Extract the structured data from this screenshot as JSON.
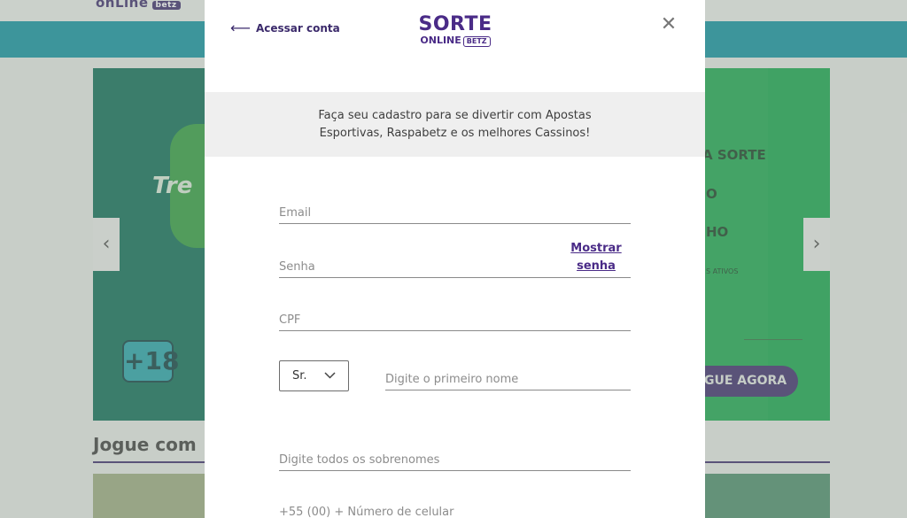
{
  "background": {
    "logo_text": "onLine",
    "logo_badge": "betz",
    "hero_brand": "Tre",
    "hero_lines": [
      "A SORTE",
      "O",
      "HO"
    ],
    "hero_small": "S ATIVOS",
    "age_badge": "+18",
    "play_button": "GUE AGORA",
    "section_title": "Jogue com",
    "arrow_left": "‹",
    "arrow_right": "›"
  },
  "modal": {
    "back_arrow": "⟵",
    "back_label": "Acessar conta",
    "logo_line1": "SORTE",
    "logo_line2": "ONLINE",
    "logo_badge": "BETZ",
    "close_symbol": "✕",
    "intro_text": "Faça seu cadastro para se divertir com Apostas Esportivas, Raspabetz e os melhores Cassinos!",
    "fields": {
      "email_placeholder": "Email",
      "password_placeholder": "Senha",
      "show_password": "Mostrar senha",
      "cpf_placeholder": "CPF",
      "title_value": "Sr.",
      "first_name_placeholder": "Digite o primeiro nome",
      "last_name_placeholder": "Digite todos os sobrenomes",
      "phone_placeholder": "+55 (00) + Número de celular"
    }
  }
}
